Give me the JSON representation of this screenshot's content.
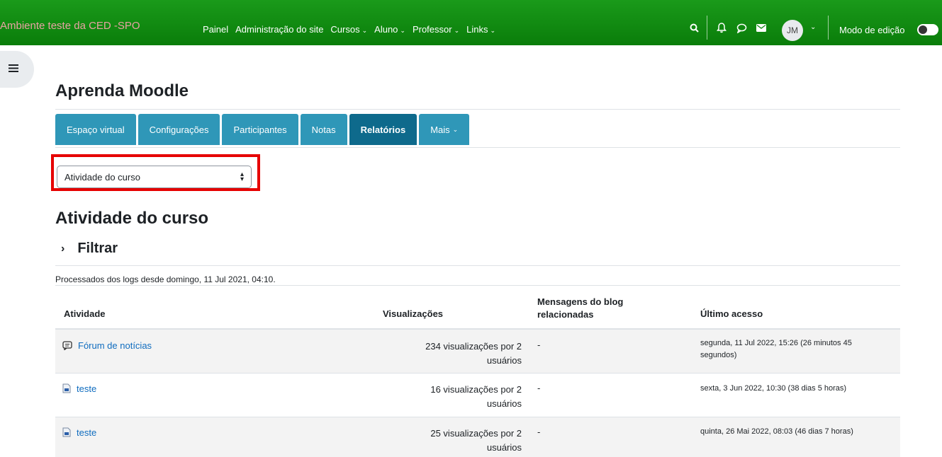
{
  "navbar": {
    "brand": "Ambiente teste da CED -SPO",
    "links": [
      "Painel",
      "Administração do site",
      "Cursos",
      "Aluno",
      "Professor",
      "Links"
    ],
    "dropdown_links": [
      false,
      false,
      true,
      true,
      true,
      true
    ],
    "avatar_initials": "JM",
    "edit_mode_label": "Modo de edição",
    "background": "#128a12"
  },
  "course": {
    "title": "Aprenda Moodle"
  },
  "tabs": [
    {
      "label": "Espaço virtual",
      "active": false
    },
    {
      "label": "Configurações",
      "active": false
    },
    {
      "label": "Participantes",
      "active": false
    },
    {
      "label": "Notas",
      "active": false
    },
    {
      "label": "Relatórios",
      "active": true
    },
    {
      "label": "Mais",
      "active": false
    }
  ],
  "report_select": {
    "value": "Atividade do curso",
    "highlight_color": "#e60000"
  },
  "report": {
    "heading": "Atividade do curso",
    "filter_label": "Filtrar",
    "processed_text": "Processados dos logs desde domingo, 11 Jul 2021, 04:10."
  },
  "table": {
    "headers": {
      "activity": "Atividade",
      "views": "Visualizações",
      "blog_line1": "Mensagens do blog",
      "blog_line2": "relacionadas",
      "last_access": "Último acesso"
    },
    "rows": [
      {
        "icon": "forum-icon",
        "activity": "Fórum de notícias",
        "views_line1": "234 visualizações por 2",
        "views_line2": "usuários",
        "blog": "-",
        "last1": "segunda, 11 Jul 2022, 15:26 (26 minutos 45",
        "last2": "segundos)"
      },
      {
        "icon": "file-icon",
        "activity": "teste",
        "views_line1": "16 visualizações por 2",
        "views_line2": "usuários",
        "blog": "-",
        "last1": "sexta, 3 Jun 2022, 10:30 (38 dias 5 horas)",
        "last2": ""
      },
      {
        "icon": "file-icon",
        "activity": "teste",
        "views_line1": "25 visualizações por 2",
        "views_line2": "usuários",
        "blog": "-",
        "last1": "quinta, 26 Mai 2022, 08:03 (46 dias 7 horas)",
        "last2": ""
      }
    ]
  }
}
